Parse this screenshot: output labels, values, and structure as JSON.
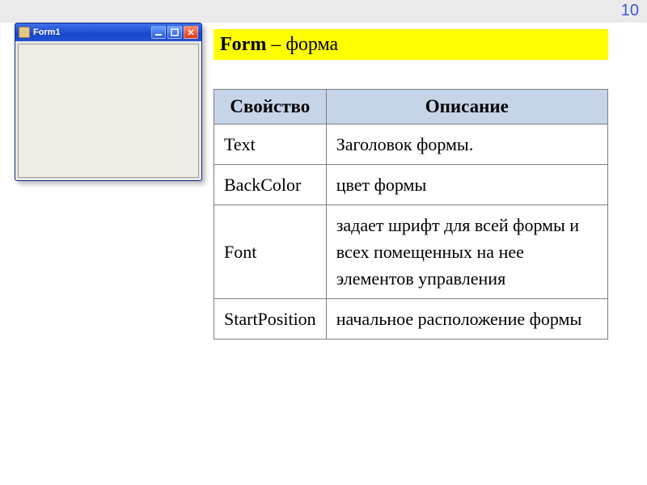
{
  "page_number": "10",
  "title": {
    "strong": "Form",
    "rest": "– форма"
  },
  "window": {
    "title": "Form1"
  },
  "table": {
    "headers": {
      "property": "Свойство",
      "description": "Описание"
    },
    "rows": [
      {
        "property": "Text",
        "description": "Заголовок формы."
      },
      {
        "property": "BackColor",
        "description": " цвет формы"
      },
      {
        "property": "Font",
        "description": "задает шрифт для всей формы и всех помещенных на нее элементов управления"
      },
      {
        "property": "StartPosition",
        "description": "начальное расположение формы"
      }
    ]
  }
}
